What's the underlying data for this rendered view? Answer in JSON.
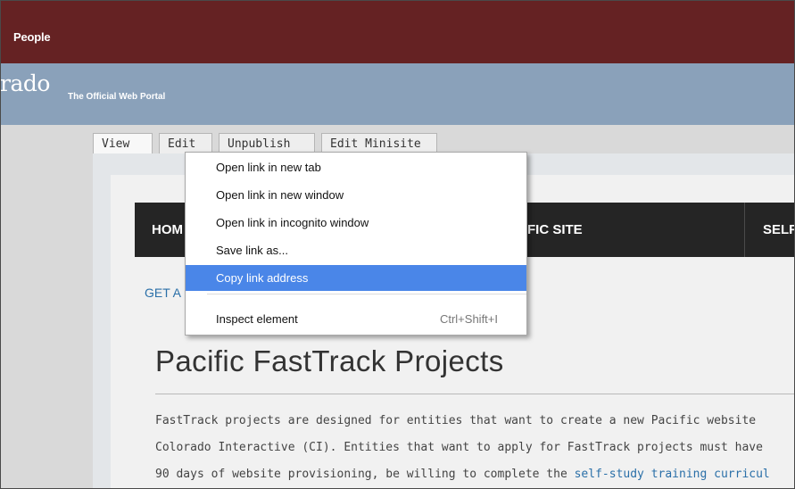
{
  "admin_bar": {
    "people_link": "People",
    "color": "#652223"
  },
  "portal": {
    "logo_text": "rado",
    "tagline": "The Official Web Portal",
    "color": "#8aa1ba"
  },
  "tabs": [
    {
      "label": "View",
      "active": true
    },
    {
      "label": "Edit"
    },
    {
      "label": "Unpublish"
    },
    {
      "label": "Edit Minisite"
    }
  ],
  "nav": {
    "items": [
      {
        "label": "HOM"
      },
      {
        "label": "FIC SITE"
      },
      {
        "label": "SELF-STUDY TRAINI"
      }
    ]
  },
  "breadcrumb_link": "GET A",
  "page_title": "Pacific FastTrack Projects",
  "paragraph": {
    "line1": "FastTrack projects are designed for entities that want to create a new Pacific website",
    "line2": "Colorado Interactive (CI). Entities that want to apply for FastTrack projects must have",
    "line3_prefix": "90 days of website provisioning, be willing to complete the ",
    "line3_link": "self-study training curricul"
  },
  "context_menu": {
    "items": [
      {
        "label": "Open link in new tab"
      },
      {
        "label": "Open link in new window"
      },
      {
        "label": "Open link in incognito window"
      },
      {
        "label": "Save link as..."
      },
      {
        "label": "Copy link address",
        "highlighted": true
      },
      {
        "label": "Inspect element",
        "shortcut": "Ctrl+Shift+I"
      }
    ],
    "highlight_color": "#4a86e8"
  }
}
